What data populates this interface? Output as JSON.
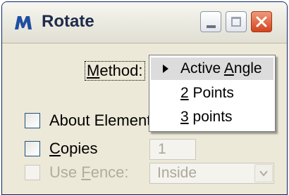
{
  "window": {
    "title": "Rotate",
    "app_icon": "microstation-m-icon",
    "controls": {
      "minimize": "minimize-icon",
      "maximize": "maximize-icon",
      "close": "close-icon"
    }
  },
  "method": {
    "label_prefix": "",
    "label_accel": "M",
    "label_rest": "ethod:",
    "menu_items": [
      {
        "pre": "Active ",
        "accel": "A",
        "post": "ngle",
        "selected": true
      },
      {
        "pre": "",
        "accel": "2",
        "post": " Points",
        "selected": false
      },
      {
        "pre": "",
        "accel": "3",
        "post": " points",
        "selected": false
      }
    ]
  },
  "about_element": {
    "label": "About Element",
    "checked": false
  },
  "copies": {
    "accel": "C",
    "label_rest": "opies",
    "checked": false,
    "value": "1",
    "enabled": false
  },
  "use_fence": {
    "pre": "Use ",
    "accel": "F",
    "post": "ence:",
    "checked": false,
    "enabled": false,
    "mode_value": "Inside"
  },
  "colors": {
    "accent_title": "#1e2b4a",
    "close_button": "#d2431e",
    "disabled_text": "#b0ad9e"
  }
}
